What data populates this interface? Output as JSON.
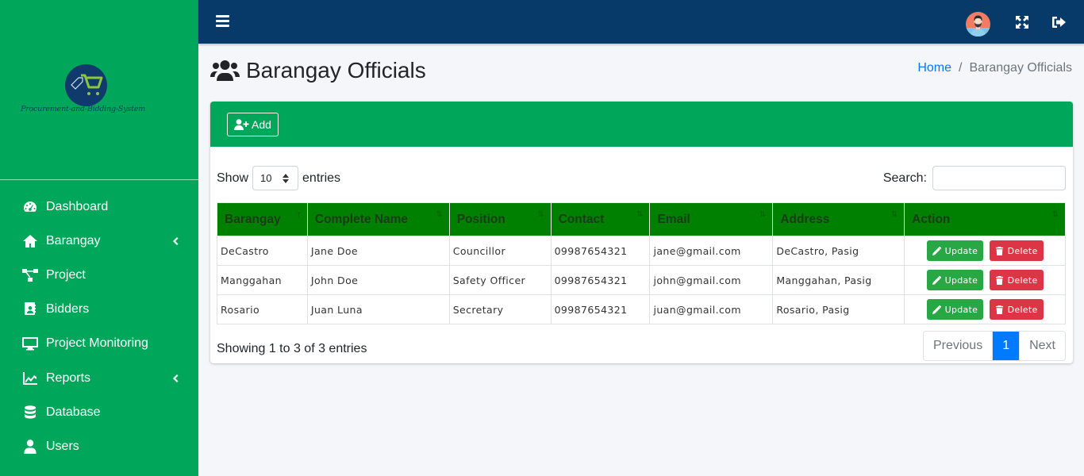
{
  "brand": {
    "name": "Procurement-and-Bidding-System",
    "colors": {
      "sidebar": "#00a65a",
      "topbar": "#073a69",
      "table_header": "#008000",
      "update": "#28a745",
      "delete": "#dc3545",
      "link": "#007bff"
    }
  },
  "sidebar": {
    "items": [
      {
        "label": "Dashboard",
        "icon": "tachometer-icon",
        "has_submenu": false
      },
      {
        "label": "Barangay",
        "icon": "home-icon",
        "has_submenu": true
      },
      {
        "label": "Project",
        "icon": "project-diagram-icon",
        "has_submenu": false
      },
      {
        "label": "Bidders",
        "icon": "address-book-icon",
        "has_submenu": false
      },
      {
        "label": "Project Monitoring",
        "icon": "desktop-icon",
        "has_submenu": false
      },
      {
        "label": "Reports",
        "icon": "chart-line-icon",
        "has_submenu": true
      },
      {
        "label": "Database",
        "icon": "database-icon",
        "has_submenu": false
      },
      {
        "label": "Users",
        "icon": "user-icon",
        "has_submenu": false
      }
    ]
  },
  "topbar": {
    "menu_icon": "hamburger-icon",
    "avatar_icon": "user-avatar",
    "fullscreen_icon": "expand-icon",
    "logout_icon": "sign-out-icon"
  },
  "page": {
    "title": "Barangay Officials",
    "title_icon": "users-icon",
    "breadcrumb": {
      "home": "Home",
      "separator": "/",
      "current": "Barangay Officials"
    }
  },
  "card": {
    "add_label": "Add",
    "show_label": "Show",
    "entries_label": "entries",
    "page_length": "10",
    "search_label": "Search:",
    "search_value": "",
    "table": {
      "columns": [
        "Barangay",
        "Complete Name",
        "Position",
        "Contact",
        "Email",
        "Address",
        "Action"
      ],
      "rows": [
        {
          "barangay": "DeCastro",
          "name": "Jane Doe",
          "position": "Councillor",
          "contact": "09987654321",
          "email": "jane@gmail.com",
          "address": "DeCastro, Pasig"
        },
        {
          "barangay": "Manggahan",
          "name": "John Doe",
          "position": "Safety Officer",
          "contact": "09987654321",
          "email": "john@gmail.com",
          "address": "Manggahan, Pasig"
        },
        {
          "barangay": "Rosario",
          "name": "Juan Luna",
          "position": "Secretary",
          "contact": "09987654321",
          "email": "juan@gmail.com",
          "address": "Rosario, Pasig"
        }
      ],
      "update_label": "Update",
      "delete_label": "Delete"
    },
    "info": "Showing 1 to 3 of 3 entries",
    "pagination": {
      "previous": "Previous",
      "current": "1",
      "next": "Next"
    }
  }
}
